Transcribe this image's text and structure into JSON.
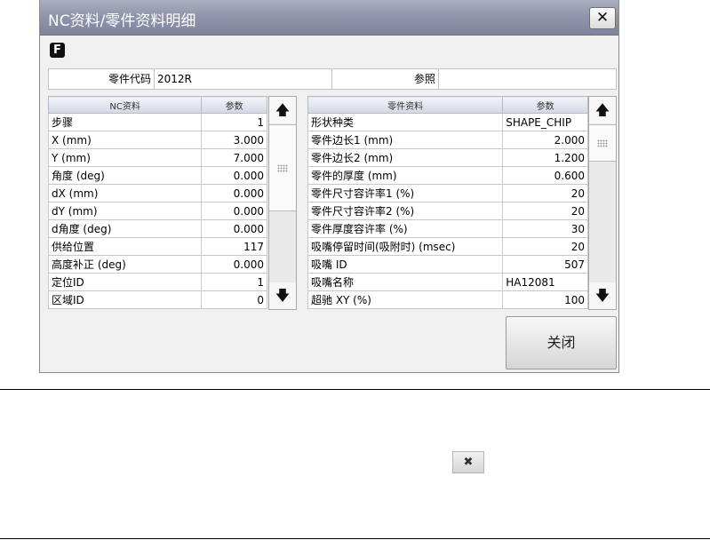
{
  "window": {
    "title": "NC资料/零件资料明细",
    "close_glyph": "✕"
  },
  "badge": {
    "label": "F"
  },
  "info": {
    "part_code_label": "零件代码",
    "part_code_value": "2012R",
    "reference_label": "参照",
    "reference_value": ""
  },
  "nc_table": {
    "headers": [
      "NC资料",
      "参数"
    ],
    "rows": [
      [
        "步骤",
        "1"
      ],
      [
        "X (mm)",
        "3.000"
      ],
      [
        "Y (mm)",
        "7.000"
      ],
      [
        "角度 (deg)",
        "0.000"
      ],
      [
        "dX (mm)",
        "0.000"
      ],
      [
        "dY (mm)",
        "0.000"
      ],
      [
        "d角度 (deg)",
        "0.000"
      ],
      [
        "供给位置",
        "117"
      ],
      [
        "高度补正 (deg)",
        "0.000"
      ],
      [
        "定位ID",
        "1"
      ],
      [
        "区域ID",
        "0"
      ]
    ]
  },
  "part_table": {
    "headers": [
      "零件资料",
      "参数"
    ],
    "rows": [
      [
        "形状种类",
        "SHAPE_CHIP"
      ],
      [
        "零件边长1 (mm)",
        "2.000"
      ],
      [
        "零件边长2 (mm)",
        "1.200"
      ],
      [
        "零件的厚度 (mm)",
        "0.600"
      ],
      [
        "零件尺寸容许率1 (%)",
        "20"
      ],
      [
        "零件尺寸容许率2 (%)",
        "20"
      ],
      [
        "零件厚度容许率 (%)",
        "30"
      ],
      [
        "吸嘴停留时间(吸附时) (msec)",
        "20"
      ],
      [
        "吸嘴 ID",
        "507"
      ],
      [
        "吸嘴名称",
        "HA12081"
      ],
      [
        "超驰 XY (%)",
        "100"
      ]
    ]
  },
  "scroll": {
    "up_glyph": "🡅",
    "down_glyph": "🡇"
  },
  "buttons": {
    "close_label": "关闭",
    "small_close_glyph": "✖"
  }
}
